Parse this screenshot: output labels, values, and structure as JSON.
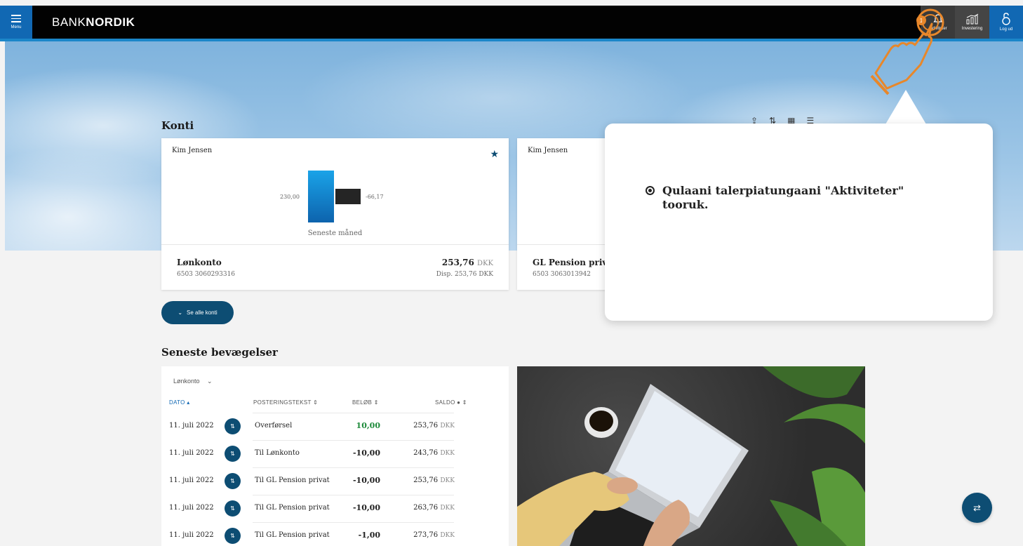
{
  "header": {
    "menu_label": "Menu",
    "logo_regular": "BANK",
    "logo_bold": "NORDIK",
    "nav": {
      "activities_label": "Aktiviteter",
      "activities_badge": "1",
      "investing_label": "Investering",
      "logout_label": "Log ud"
    }
  },
  "accounts": {
    "title": "Konti",
    "cards": [
      {
        "owner": "Kim Jensen",
        "favorite": true,
        "chart": {
          "income": "230,00",
          "expense": "-66,17",
          "caption": "Seneste måned"
        },
        "name": "Lønkonto",
        "number": "6503 3060293316",
        "balance": "253,76",
        "currency": "DKK",
        "disposable": "Disp. 253,76 DKK"
      },
      {
        "owner": "Kim Jensen",
        "name": "GL Pension privat",
        "number": "6503 3063013942"
      }
    ],
    "see_all_label": "Se alle konti"
  },
  "transactions": {
    "title": "Seneste bevægelser",
    "account_filter": "Lønkonto",
    "columns": [
      "DATO",
      "POSTERINGSTEKST",
      "BELØB",
      "SALDO"
    ],
    "rows": [
      {
        "date": "11. juli 2022",
        "text": "Overførsel",
        "amount": "10,00",
        "balance": "253,76",
        "currency": "DKK"
      },
      {
        "date": "11. juli 2022",
        "text": "Til Lønkonto",
        "amount": "-10,00",
        "balance": "243,76",
        "currency": "DKK"
      },
      {
        "date": "11. juli 2022",
        "text": "Til GL Pension privat",
        "amount": "-10,00",
        "balance": "253,76",
        "currency": "DKK"
      },
      {
        "date": "11. juli 2022",
        "text": "Til GL Pension privat",
        "amount": "-10,00",
        "balance": "263,76",
        "currency": "DKK"
      },
      {
        "date": "11. juli 2022",
        "text": "Til GL Pension privat",
        "amount": "-1,00",
        "balance": "273,76",
        "currency": "DKK"
      }
    ]
  },
  "tooltip": {
    "text": "Qulaani talerpiatungaani \"Aktiviteter\" tooruk."
  },
  "colors": {
    "brand_blue": "#1168b3",
    "dark_teal": "#0d4d73",
    "positive_green": "#1d8a3a",
    "pointer_orange": "#e8872a"
  },
  "icons": [
    "menu-icon",
    "bell-icon",
    "investment-chart-icon",
    "logout-lock-icon",
    "star-icon",
    "export-icon",
    "sort-icon",
    "grid-view-icon",
    "list-view-icon",
    "chevron-down-icon",
    "transfer-icon",
    "pointing-hand-icon"
  ]
}
